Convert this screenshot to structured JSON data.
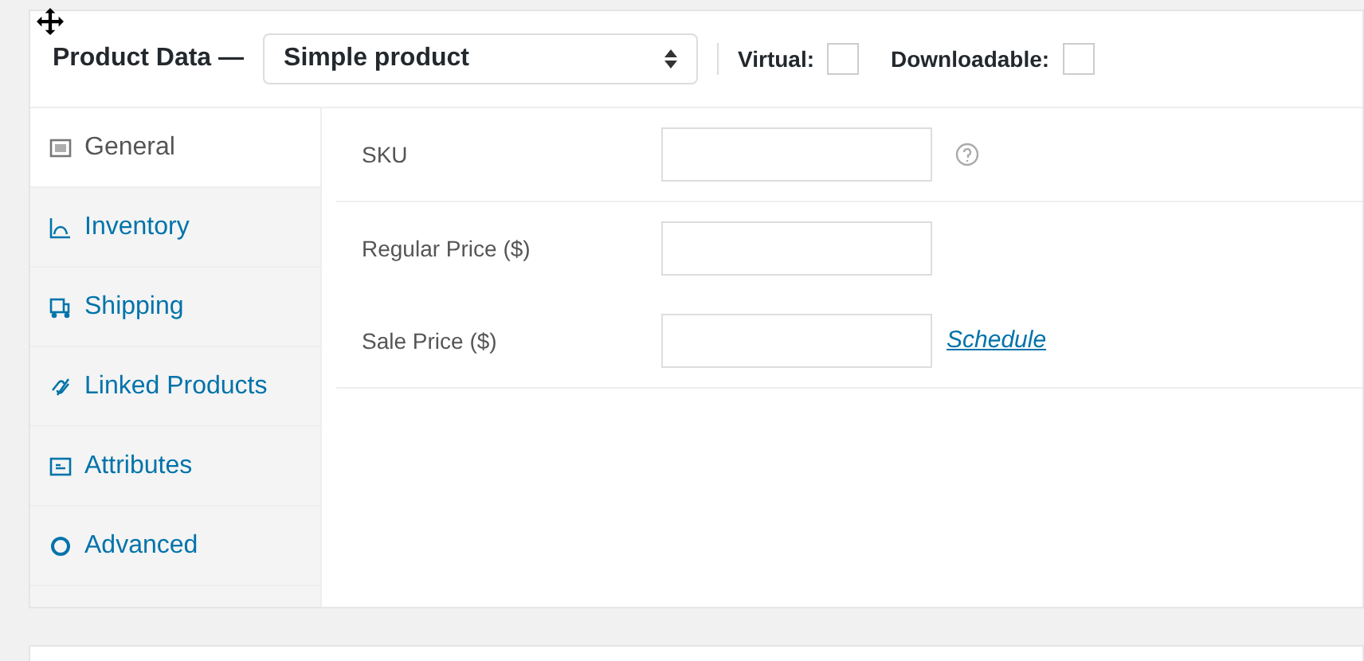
{
  "header": {
    "title": "Product Data —",
    "product_type": "Simple product",
    "options": [
      {
        "label": "Virtual:",
        "checked": false
      },
      {
        "label": "Downloadable:",
        "checked": false
      }
    ]
  },
  "tabs": [
    {
      "label": "General",
      "kind": "general",
      "selected": true
    },
    {
      "label": "Inventory",
      "kind": "inventory",
      "selected": false
    },
    {
      "label": "Shipping",
      "kind": "shipping",
      "selected": false
    },
    {
      "label": "Linked Products",
      "kind": "linked",
      "selected": false
    },
    {
      "label": "Attributes",
      "kind": "attributes",
      "selected": false
    },
    {
      "label": "Advanced",
      "kind": "advanced",
      "selected": false
    }
  ],
  "groups": [
    [
      {
        "label": "SKU",
        "help": true
      }
    ],
    [
      {
        "label": "Regular Price ($)"
      },
      {
        "label": "Sale Price ($)",
        "link": "Schedule"
      }
    ]
  ]
}
